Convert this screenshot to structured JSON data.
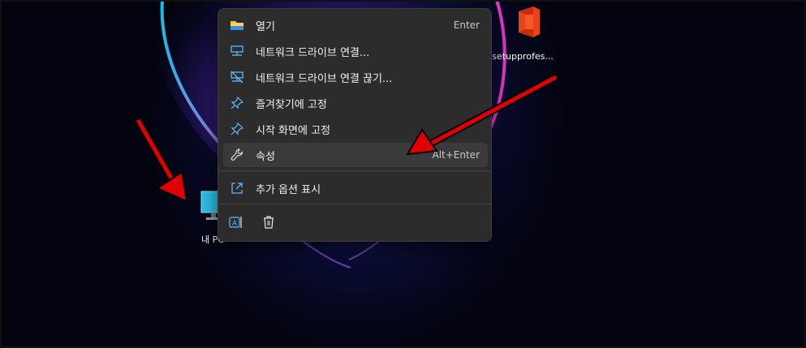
{
  "desktop": {
    "icons": [
      {
        "label": "내 PC",
        "name": "my-pc"
      },
      {
        "label": "setupprofes...",
        "name": "setup-office"
      }
    ]
  },
  "context_menu": {
    "items": [
      {
        "label": "열기",
        "shortcut": "Enter",
        "icon": "folder-icon"
      },
      {
        "label": "네트워크 드라이브 연결...",
        "shortcut": "",
        "icon": "network-drive-icon"
      },
      {
        "label": "네트워크 드라이브 연결 끊기...",
        "shortcut": "",
        "icon": "network-drive-disconnect-icon"
      },
      {
        "label": "즐겨찾기에 고정",
        "shortcut": "",
        "icon": "pin-icon"
      },
      {
        "label": "시작 화면에 고정",
        "shortcut": "",
        "icon": "pin-icon"
      },
      {
        "label": "속성",
        "shortcut": "Alt+Enter",
        "icon": "wrench-icon"
      },
      {
        "label": "추가 옵션 표시",
        "shortcut": "",
        "icon": "expand-icon"
      }
    ],
    "bottom_actions": [
      {
        "icon": "rename-icon"
      },
      {
        "icon": "trash-icon"
      }
    ]
  },
  "colors": {
    "menu_bg": "#2c2c2c",
    "highlight": "#3a3a3a",
    "accent_red": "#e00000",
    "icon_blue": "#5fb8ff"
  }
}
